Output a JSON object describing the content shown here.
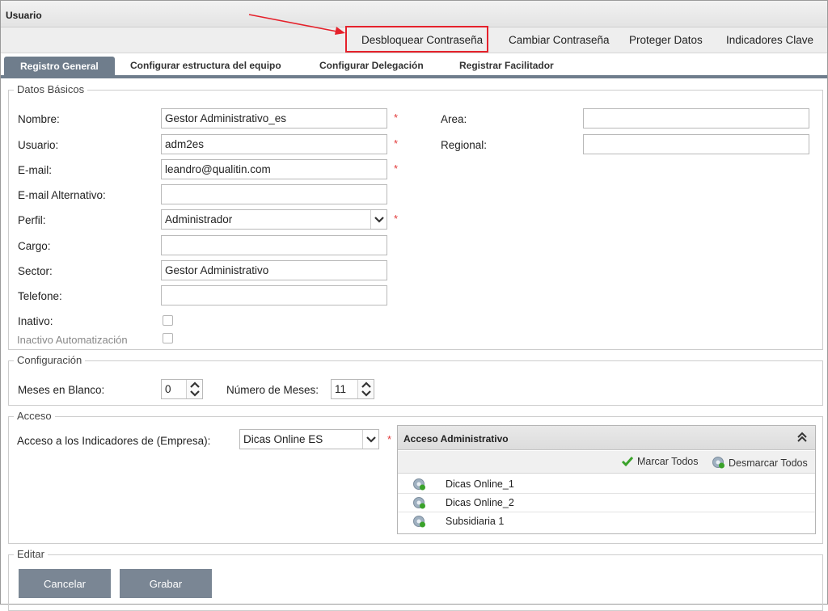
{
  "window": {
    "title": "Usuario"
  },
  "toolbar": {
    "unlock_password": "Desbloquear Contraseña",
    "change_password": "Cambiar Contraseña",
    "protect_data": "Proteger Datos",
    "key_indicators": "Indicadores Clave"
  },
  "tabs": [
    {
      "label": "Registro General"
    },
    {
      "label": "Configurar estructura del equipo"
    },
    {
      "label": "Configurar Delegación"
    },
    {
      "label": "Registrar Facilitador"
    }
  ],
  "basic": {
    "legend": "Datos Básicos",
    "name_label": "Nombre:",
    "name_value": "Gestor Administrativo_es",
    "user_label": "Usuario:",
    "user_value": "adm2es",
    "email_label": "E-mail:",
    "email_value": "leandro@qualitin.com",
    "email_alt_label": "E-mail Alternativo:",
    "email_alt_value": "",
    "profile_label": "Perfil:",
    "profile_value": "Administrador",
    "position_label": "Cargo:",
    "position_value": "",
    "sector_label": "Sector:",
    "sector_value": "Gestor Administrativo",
    "phone_label": "Telefone:",
    "phone_value": "",
    "inactive_label": "Inativo:",
    "inactive_auto_label": "Inactivo Automatización",
    "area_label": "Area:",
    "area_value": "",
    "regional_label": "Regional:",
    "regional_value": "",
    "required_mark": "*"
  },
  "config": {
    "legend": "Configuración",
    "blank_months_label": "Meses en Blanco:",
    "blank_months_value": "0",
    "months_count_label": "Número de Meses:",
    "months_count_value": "11"
  },
  "access": {
    "legend": "Acceso",
    "indicators_label": "Acceso a los Indicadores de (Empresa):",
    "indicators_value": "Dicas Online ES",
    "panel_title": "Acceso Administrativo",
    "mark_all": "Marcar Todos",
    "unmark_all": "Desmarcar Todos",
    "items": [
      {
        "label": "Dicas Online_1"
      },
      {
        "label": "Dicas Online_2"
      },
      {
        "label": "Subsidiaria 1"
      }
    ]
  },
  "edit": {
    "legend": "Editar",
    "cancel": "Cancelar",
    "save": "Grabar"
  },
  "colors": {
    "accent": "#6f7d8c",
    "button": "#7a8694",
    "highlight": "#e5212b",
    "required": "#e23a3a",
    "check": "#3aa22a"
  }
}
